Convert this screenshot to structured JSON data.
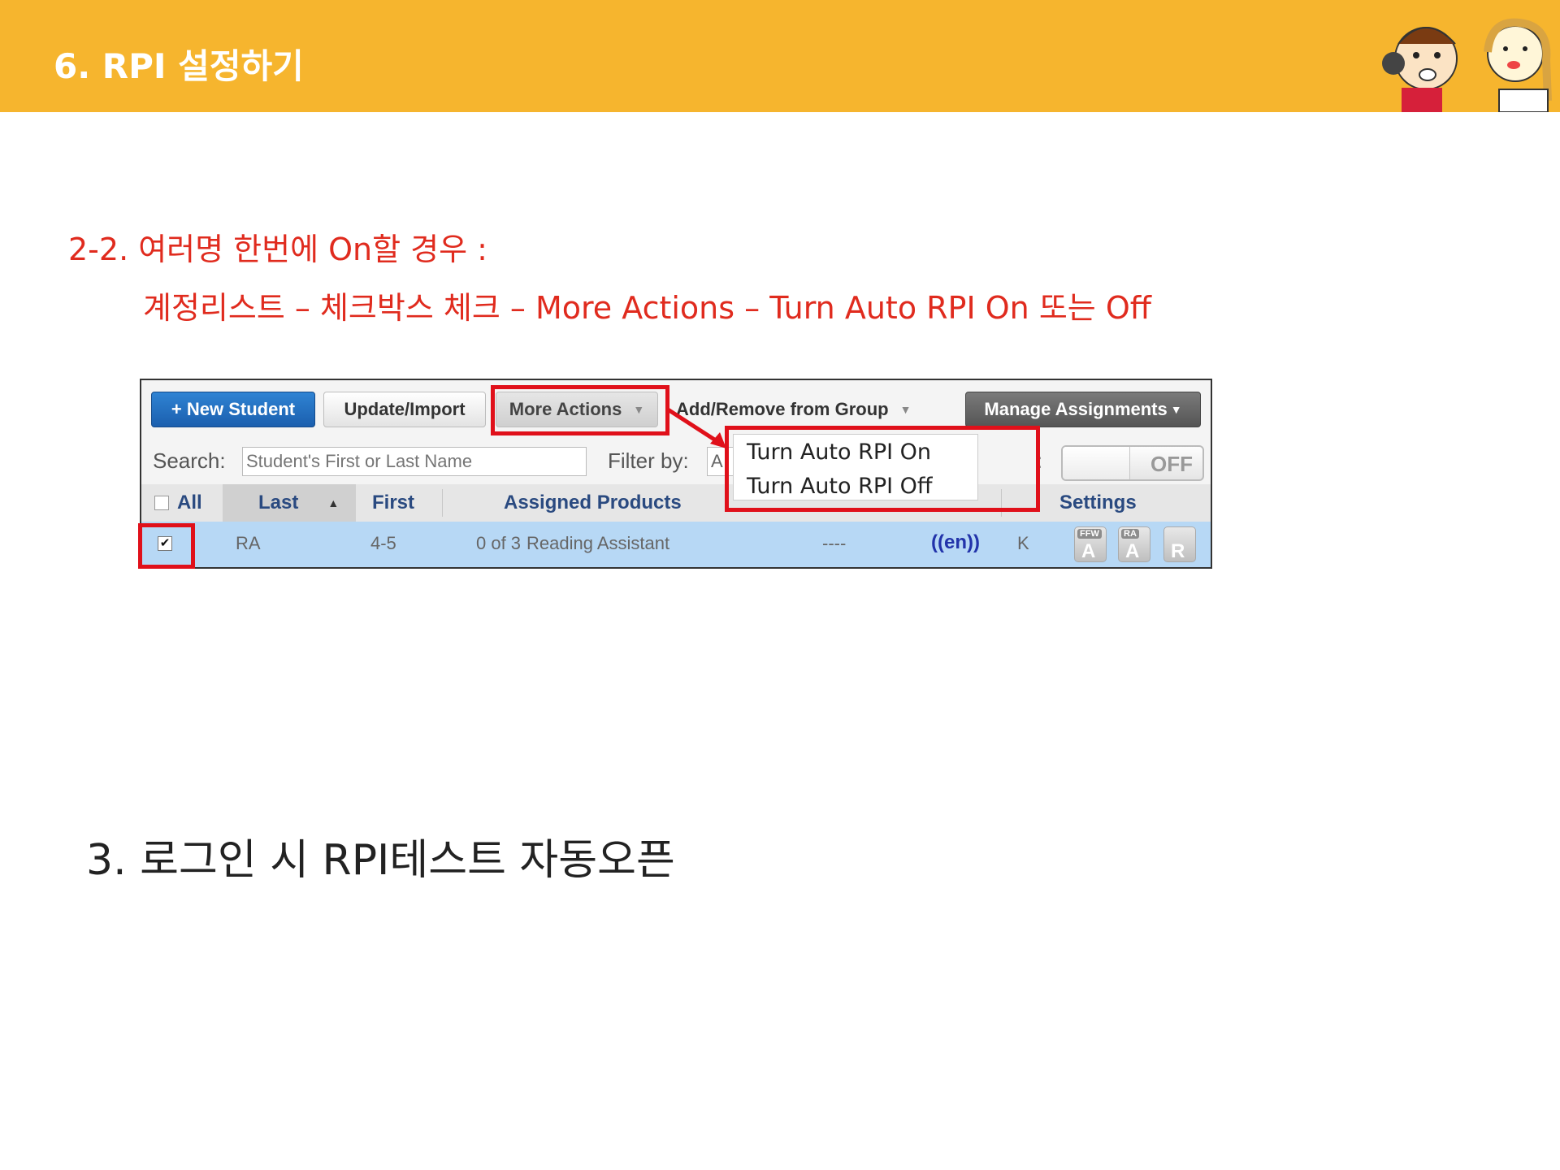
{
  "slide": {
    "title": "6. RPI 설정하기",
    "subtitle_red": "2-2. 여러명 한번에 On할 경우 :",
    "instruction_red": "계정리스트 – 체크박스 체크 – More Actions – Turn Auto RPI On 또는 Off",
    "section3": "3. 로그인 시 RPI테스트 자동오픈"
  },
  "colors": {
    "banner": "#f6b52e",
    "highlight": "#e0101a",
    "instruction": "#e02b1e"
  },
  "app": {
    "toolbar": {
      "new_student": "+ New Student",
      "update_import": "Update/Import",
      "more_actions": "More Actions",
      "add_remove_group": "Add/Remove from Group",
      "manage_assignments": "Manage Assignments"
    },
    "search": {
      "label": "Search:",
      "placeholder": "Student's First or Last Name",
      "filter_label": "Filter by:",
      "filter_value": "A",
      "toggle": "OFF"
    },
    "dropdown": {
      "items": [
        "Turn Auto RPI On",
        "Turn Auto RPI Off"
      ]
    },
    "table": {
      "headers": [
        "All",
        "Last",
        "First",
        "Assigned Products",
        "Settings"
      ],
      "rows": [
        {
          "last": "RA",
          "first": "4-5",
          "assigned": "0 of 3",
          "product": "Reading Assistant",
          "protocol": "----",
          "lang": "((en))",
          "gr": "K",
          "badges": [
            {
              "top": "FFW",
              "letter": "A"
            },
            {
              "top": "RA",
              "letter": "A"
            },
            {
              "top": "",
              "letter": "R"
            }
          ]
        }
      ]
    }
  }
}
